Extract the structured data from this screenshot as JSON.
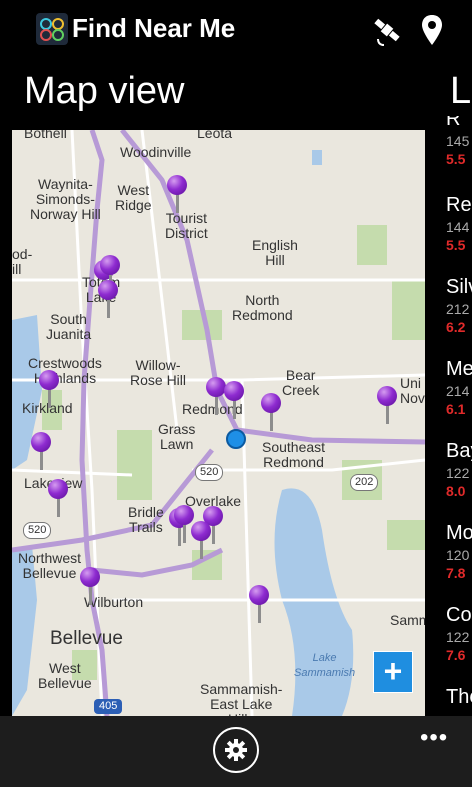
{
  "header": {
    "app_title": "Find Near Me",
    "icons": [
      "app-logo-icon",
      "satellite-icon",
      "location-pin-icon"
    ]
  },
  "section_title": "Map view",
  "next_section_title_partial": "Li",
  "map": {
    "labels": [
      {
        "text": "Bothell"
      },
      {
        "text": "Leota"
      },
      {
        "text": "Woodinville"
      },
      {
        "text": "Waynita-\nSimonds-\nNorway Hill"
      },
      {
        "text": "West\nRidge"
      },
      {
        "text": "Tourist\nDistrict"
      },
      {
        "text": "English\nHill"
      },
      {
        "text": "od-\nill"
      },
      {
        "text": "Totem\nLake"
      },
      {
        "text": "North\nRedmond"
      },
      {
        "text": "South\nJuanita"
      },
      {
        "text": "Crestwoods\nHighlands"
      },
      {
        "text": "Willow-\nRose Hill"
      },
      {
        "text": "Bear\nCreek"
      },
      {
        "text": "Uni\nNov"
      },
      {
        "text": "Kirkland"
      },
      {
        "text": "Redmond"
      },
      {
        "text": "Grass\nLawn"
      },
      {
        "text": "Southeast\nRedmond"
      },
      {
        "text": "Lakeview"
      },
      {
        "text": "Overlake"
      },
      {
        "text": "520"
      },
      {
        "text": "202"
      },
      {
        "text": "520"
      },
      {
        "text": "Bridle\nTrails"
      },
      {
        "text": "Northwest\nBellevue"
      },
      {
        "text": "Wilburton"
      },
      {
        "text": "Samm"
      },
      {
        "text": "Bellevue"
      },
      {
        "text": "Lake\nSammamish"
      },
      {
        "text": "West\nBellevue"
      },
      {
        "text": "405"
      },
      {
        "text": "Sammamish-\nEast Lake\nHills"
      }
    ],
    "add_button_label": "+"
  },
  "list": {
    "items": [
      {
        "name": "R",
        "address": "145",
        "distance": "5.5"
      },
      {
        "name": "Res",
        "address": "144",
        "distance": "5.5"
      },
      {
        "name": "Silv",
        "address": "212",
        "distance": "6.2"
      },
      {
        "name": "Me",
        "address": "214",
        "distance": "6.1"
      },
      {
        "name": "Bay",
        "address": "122",
        "distance": "8.0"
      },
      {
        "name": "Mo",
        "address": "120",
        "distance": "7.8"
      },
      {
        "name": "Co",
        "address": "122",
        "distance": "7.6"
      },
      {
        "name": "The",
        "address": "",
        "distance": ""
      }
    ]
  },
  "appbar": {
    "settings_icon": "gear-icon",
    "more_label": "•••"
  },
  "colors": {
    "pin": "#8e2bd0",
    "distance": "#e02a2a",
    "accent": "#1f8ee0"
  }
}
